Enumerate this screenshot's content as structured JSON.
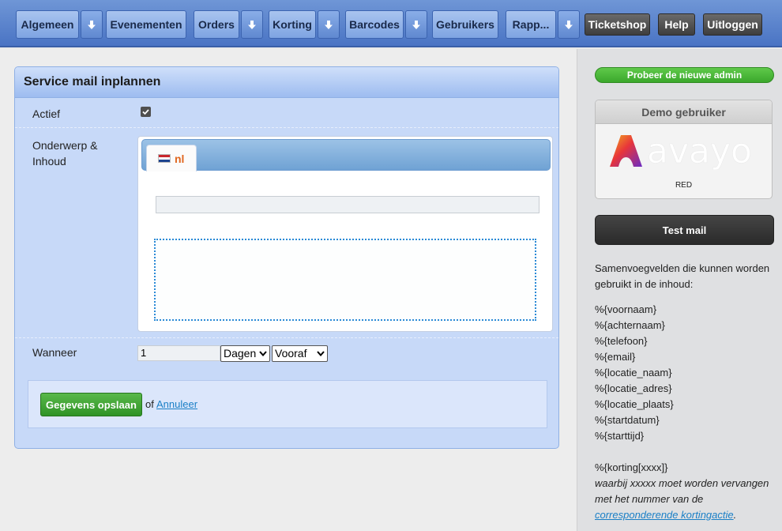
{
  "nav": {
    "algemeen": "Algemeen",
    "evenementen": "Evenementen",
    "orders": "Orders",
    "korting": "Korting",
    "barcodes": "Barcodes",
    "gebruikers": "Gebruikers",
    "rapp": "Rapp...",
    "ticketshop": "Ticketshop",
    "help": "Help",
    "uitloggen": "Uitloggen"
  },
  "panel": {
    "title": "Service mail inplannen",
    "actief_label": "Actief",
    "actief_checked": true,
    "onderwerp_label_line1": "Onderwerp &",
    "onderwerp_label_line2": "Inhoud",
    "lang_tab": "nl",
    "subject_value": "",
    "content_value": "",
    "wanneer_label": "Wanneer",
    "wanneer_value": "1",
    "unit_select": "Dagen",
    "timing_select": "Vooraf",
    "save_label": "Gegevens opslaan",
    "or_text": "of",
    "cancel_label": "Annuleer"
  },
  "sidebar": {
    "try_new": "Probeer de nieuwe admin",
    "demo_title": "Demo gebruiker",
    "demo_brand": "avayo",
    "demo_sub": "RED",
    "test_mail": "Test mail",
    "merge_intro_line1": "Samenvoegvelden die kunnen worden",
    "merge_intro_line2": "gebruikt in de inhoud:",
    "merge_fields": [
      "%{voornaam}",
      "%{achternaam}",
      "%{telefoon}",
      "%{email}",
      "%{locatie_naam}",
      "%{locatie_adres}",
      "%{locatie_plaats}",
      "%{startdatum}",
      "%{starttijd}"
    ],
    "korting_field": "%{korting[xxxx]}",
    "korting_note_line1": "waarbij xxxxx moet worden vervangen",
    "korting_note_line2": "met het nummer van de",
    "korting_link": "corresponderende kortingactie",
    "korting_end": "."
  },
  "colors": {
    "nav_bg": "#4a74c4",
    "panel_bg": "#c7d9f8",
    "save_green": "#3ba82c",
    "link_blue": "#1a7fc6",
    "lang_orange": "#e0661e"
  }
}
